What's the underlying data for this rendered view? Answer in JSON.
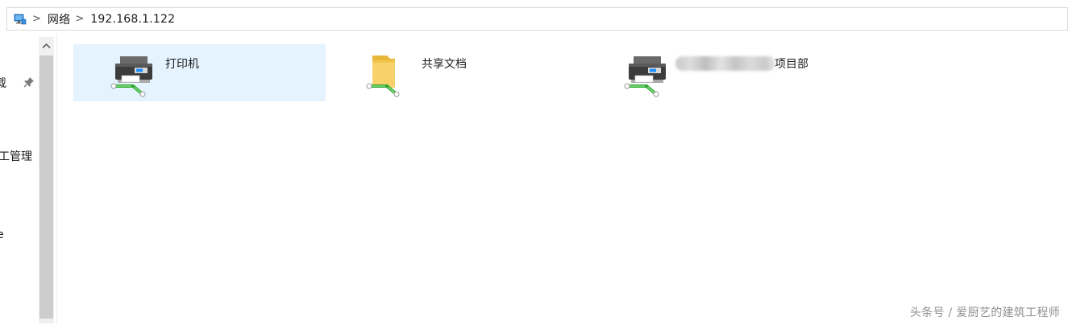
{
  "address_bar": {
    "segments": [
      "网络",
      "192.168.1.122"
    ],
    "separator": ">"
  },
  "nav_pane": {
    "items": [
      {
        "label": "载",
        "pinned": true
      },
      {
        "label": "工管理"
      },
      {
        "label": "e"
      }
    ]
  },
  "items": [
    {
      "label": "打印机",
      "type": "shared-printer",
      "selected": true
    },
    {
      "label": "共享文档",
      "type": "shared-folder",
      "selected": false
    },
    {
      "label": "项目部",
      "type": "shared-printer",
      "selected": false,
      "label_partially_obscured": true
    }
  ],
  "watermark": "头条号 / 爱厨艺的建筑工程师",
  "colors": {
    "selection": "#e5f3ff",
    "scroll_thumb": "#cdcdcd",
    "network_green": "#3fbf3f"
  }
}
